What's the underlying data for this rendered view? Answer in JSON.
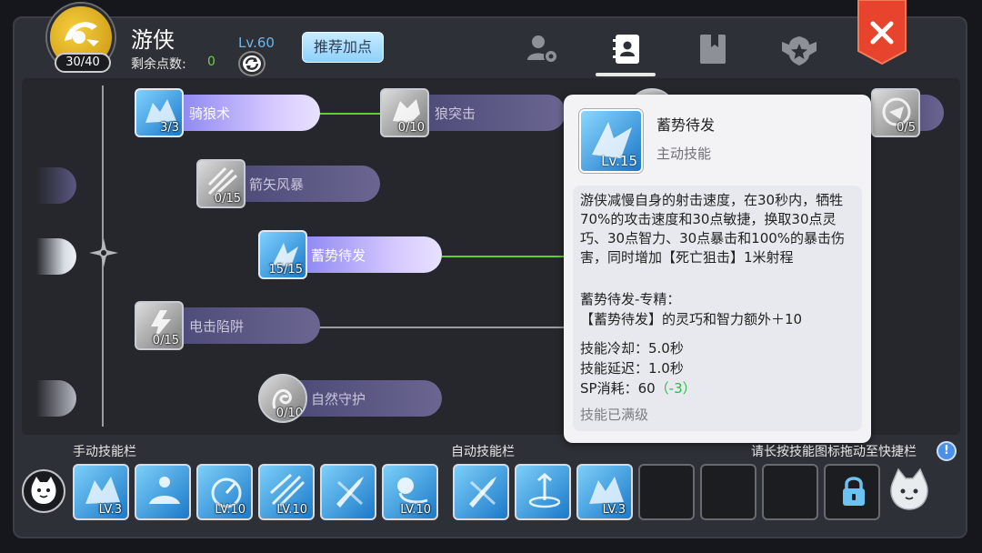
{
  "header": {
    "job_name": "游侠",
    "level": "Lv.60",
    "remaining_label": "剩余点数:",
    "remaining_value": "0",
    "sp_used": "30/40",
    "recommend_button": "推荐加点"
  },
  "tabs": [
    {
      "name": "character-skill-tab",
      "icon": "person-gear-icon"
    },
    {
      "name": "skill-book-tab",
      "icon": "contact-book-icon",
      "active": true
    },
    {
      "name": "bookmark-tab",
      "icon": "bookmark-book-icon"
    },
    {
      "name": "guild-emblem-tab",
      "icon": "star-emblem-icon"
    }
  ],
  "skill_tree": {
    "skills": [
      {
        "name": "骑狼术",
        "level": "3/3",
        "state": "active"
      },
      {
        "name": "狼突击",
        "level": "0/10",
        "state": "inactive"
      },
      {
        "name": "箭矢风暴",
        "level": "0/15",
        "state": "inactive"
      },
      {
        "name": "蓄势待发",
        "level": "15/15",
        "state": "active"
      },
      {
        "name": "电击陷阱",
        "level": "0/15",
        "state": "inactive"
      },
      {
        "name": "自然守护",
        "level": "0/10",
        "state": "inactive"
      },
      {
        "name": "",
        "level": "0/5",
        "state": "inactive"
      }
    ]
  },
  "tooltip": {
    "skill_name": "蓄势待发",
    "skill_type": "主动技能",
    "level_badge": "Lv.15",
    "description": "游侠减慢自身的射击速度，在30秒内，牺牲70%的攻击速度和30点敏捷，换取30点灵巧、30点智力、30点暴击和100%的暴击伤害，同时增加【死亡狙击】1米射程",
    "specialization_title": "蓄势待发-专精：",
    "specialization_text": "【蓄势待发】的灵巧和智力额外＋10",
    "cooldown": "技能冷却：5.0秒",
    "delay": "技能延迟：1.0秒",
    "sp_cost_label": "SP消耗：60",
    "sp_cost_modifier": "（-3）",
    "max_level_text": "技能已满级"
  },
  "bottom_bar": {
    "manual_title": "手动技能栏",
    "auto_title": "自动技能栏",
    "hint": "请长按技能图标拖动至快捷栏",
    "help_icon": "!",
    "manual_slots": [
      {
        "level": "LV.3",
        "icon": "wolf-ride-icon"
      },
      {
        "level": "",
        "icon": "meditation-icon"
      },
      {
        "level": "LV.10",
        "icon": "speed-gauge-icon"
      },
      {
        "level": "LV.10",
        "icon": "arrow-storm-icon"
      },
      {
        "level": "",
        "icon": "broken-sword-icon"
      },
      {
        "level": "LV.10",
        "icon": "octopus-trap-icon"
      }
    ],
    "auto_slots": [
      {
        "level": "",
        "icon": "broken-sword-icon"
      },
      {
        "level": "",
        "icon": "arrow-rain-icon"
      },
      {
        "level": "LV.3",
        "icon": "wolf-ride-icon"
      },
      {
        "level": "",
        "icon": ""
      },
      {
        "level": "",
        "icon": ""
      },
      {
        "level": "",
        "icon": ""
      },
      {
        "level": "",
        "icon": "lock-icon"
      }
    ]
  },
  "colors": {
    "accent_green": "#6cd33a",
    "level_blue": "#6fb6e6",
    "close_red": "#e8432c",
    "active_bar": "#b8aef8"
  }
}
